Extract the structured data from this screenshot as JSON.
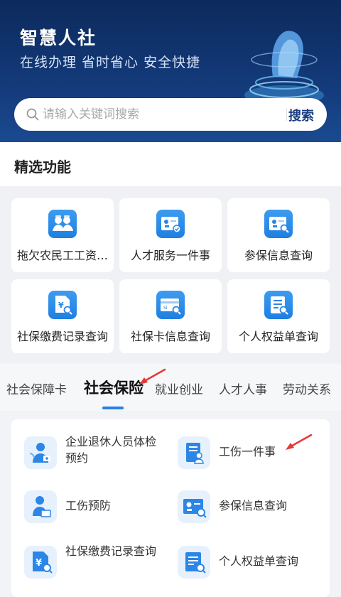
{
  "banner": {
    "title": "智慧人社",
    "subtitle": "在线办理 省时省心 安全快捷"
  },
  "search": {
    "placeholder": "请输入关键词搜索",
    "button_label": "搜索"
  },
  "featured": {
    "title": "精选功能",
    "items": [
      {
        "label": "拖欠农民工工资…",
        "icon": "workers-icon"
      },
      {
        "label": "人才服务一件事",
        "icon": "id-card-check-icon"
      },
      {
        "label": "参保信息查询",
        "icon": "id-card-search-icon"
      },
      {
        "label": "社保缴费记录查询",
        "icon": "payment-record-search-icon"
      },
      {
        "label": "社保卡信息查询",
        "icon": "bank-card-search-icon"
      },
      {
        "label": "个人权益单查询",
        "icon": "document-search-icon"
      }
    ]
  },
  "tabs": [
    {
      "label": "社会保障卡"
    },
    {
      "label": "社会保险",
      "active": true
    },
    {
      "label": "就业创业"
    },
    {
      "label": "人才人事"
    },
    {
      "label": "劳动关系"
    }
  ],
  "services": [
    {
      "label": "企业退休人员体检预约",
      "icon": "retiree-health-icon"
    },
    {
      "label": "工伤一件事",
      "icon": "document-person-icon"
    },
    {
      "label": "工伤预防",
      "icon": "person-desk-icon"
    },
    {
      "label": "参保信息查询",
      "icon": "id-card-search-icon"
    },
    {
      "label": "社保缴费记录查询",
      "icon": "payment-record-search-icon"
    },
    {
      "label": "个人权益单查询",
      "icon": "document-search-icon"
    }
  ],
  "colors": {
    "banner": "#133a7a",
    "accent": "#2b7fe6",
    "arrow": "#e53935"
  }
}
